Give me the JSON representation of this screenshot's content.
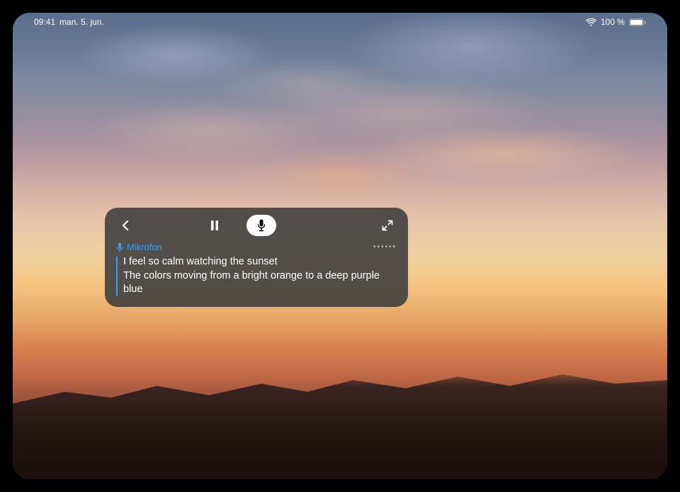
{
  "statusBar": {
    "time": "09:41",
    "date": "man. 5. jun.",
    "batteryText": "100 %"
  },
  "captionPanel": {
    "sourceLabel": "Mikrofon",
    "moreIndicator": "••••••",
    "transcriptLine1": "I feel so calm watching the sunset",
    "transcriptLine2": "The colors moving from a bright orange to a deep purple blue"
  }
}
